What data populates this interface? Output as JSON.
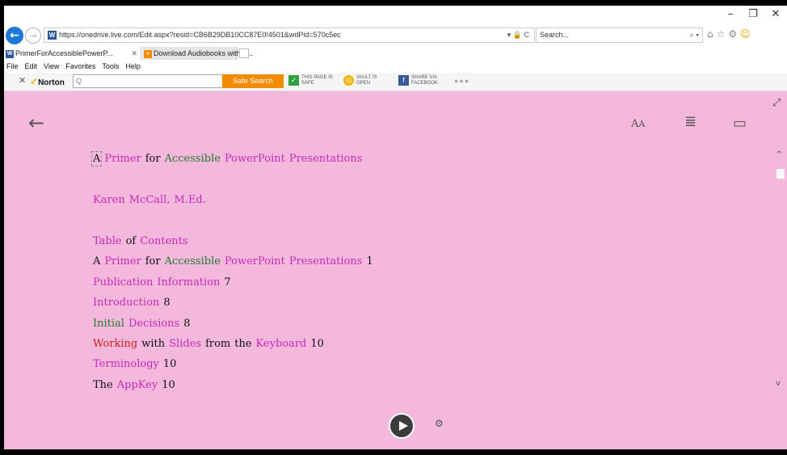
{
  "window": {
    "minimize": "–",
    "restore": "❐",
    "close": "✕"
  },
  "address_bar": {
    "url": "https://onedrive.live.com/Edit.aspx?resid=CB6B29DB10CC87E0!4501&wdPid=570c5ec",
    "icons": "▾ 🔒 C"
  },
  "search": {
    "placeholder": "Search...",
    "dropdown": "⌕ ▾"
  },
  "tabs": [
    {
      "label": "PrimerForAccessiblePowerP...",
      "close": "✕"
    },
    {
      "label": "Download Audiobooks with A..."
    }
  ],
  "menu": [
    "File",
    "Edit",
    "View",
    "Favorites",
    "Tools",
    "Help"
  ],
  "norton": {
    "close": "✕",
    "logo": "Norton",
    "search_placeholder": "Q",
    "search_button": "Safe Search",
    "page_status_top": "THIS PAGE IS",
    "page_status_bottom": "SAFE",
    "vault_top": "VAULT IS",
    "vault_bottom": "OPEN",
    "share_top": "SHARE VIA",
    "share_bottom": "FACEBOOK",
    "more": "●●●"
  },
  "reader": {
    "lines": [
      {
        "words": [
          {
            "t": "A",
            "c": "black first"
          },
          {
            "t": "Primer",
            "c": "purple"
          },
          {
            "t": "for",
            "c": "black"
          },
          {
            "t": "Accessible",
            "c": "green"
          },
          {
            "t": "PowerPoint",
            "c": "purple"
          },
          {
            "t": "Presentations",
            "c": "purple"
          }
        ],
        "gap": true
      },
      {
        "words": [
          {
            "t": "Karen",
            "c": "purple"
          },
          {
            "t": "McCall,",
            "c": "purple"
          },
          {
            "t": "M.Ed.",
            "c": "purple"
          }
        ],
        "gap": true
      },
      {
        "words": [
          {
            "t": "Table",
            "c": "purple"
          },
          {
            "t": "of",
            "c": "black"
          },
          {
            "t": "Contents",
            "c": "purple"
          }
        ]
      },
      {
        "words": [
          {
            "t": "A",
            "c": "black"
          },
          {
            "t": "Primer",
            "c": "purple"
          },
          {
            "t": "for",
            "c": "black"
          },
          {
            "t": "Accessible",
            "c": "green"
          },
          {
            "t": "PowerPoint",
            "c": "purple"
          },
          {
            "t": "Presentations",
            "c": "purple"
          },
          {
            "t": "1",
            "c": "black"
          }
        ]
      },
      {
        "words": [
          {
            "t": "Publication",
            "c": "purple"
          },
          {
            "t": "Information",
            "c": "purple"
          },
          {
            "t": "7",
            "c": "black"
          }
        ]
      },
      {
        "words": [
          {
            "t": "Introduction",
            "c": "purple"
          },
          {
            "t": "8",
            "c": "black"
          }
        ]
      },
      {
        "words": [
          {
            "t": "Initial",
            "c": "green"
          },
          {
            "t": "Decisions",
            "c": "purple"
          },
          {
            "t": "8",
            "c": "black"
          }
        ]
      },
      {
        "words": [
          {
            "t": "Working",
            "c": "red"
          },
          {
            "t": "with",
            "c": "black"
          },
          {
            "t": "Slides",
            "c": "purple"
          },
          {
            "t": "from",
            "c": "black"
          },
          {
            "t": "the",
            "c": "black"
          },
          {
            "t": "Keyboard",
            "c": "purple"
          },
          {
            "t": "10",
            "c": "black"
          }
        ]
      },
      {
        "words": [
          {
            "t": "Terminology",
            "c": "purple"
          },
          {
            "t": "10",
            "c": "black"
          }
        ]
      },
      {
        "words": [
          {
            "t": "The",
            "c": "black"
          },
          {
            "t": "AppKey",
            "c": "purple"
          },
          {
            "t": "10",
            "c": "black"
          }
        ]
      }
    ],
    "icons": {
      "back": "←",
      "text_size_big": "A",
      "text_size_small": "A",
      "preferences": "≣",
      "book": "▭",
      "expand": "⤢",
      "scroll_up": "^",
      "scroll_down": "v",
      "voice": "⚙"
    }
  },
  "colors": {
    "reader_bg": "#f3b8dc",
    "purple": "#c62ab7",
    "green": "#247a2b",
    "red": "#d11a1a"
  }
}
